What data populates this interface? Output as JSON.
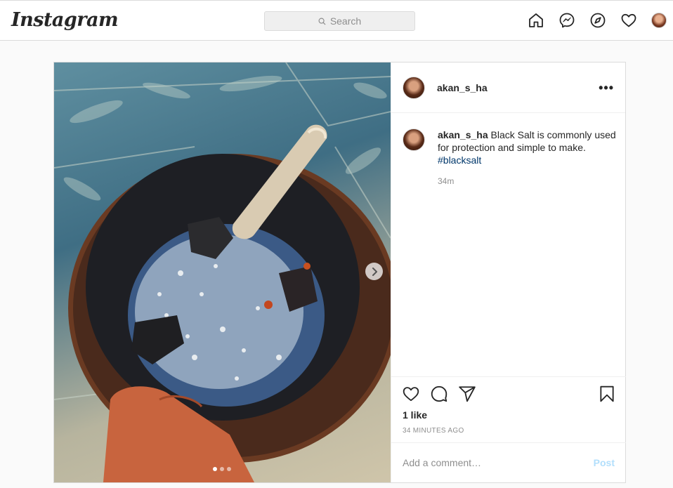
{
  "header": {
    "logo": "Instagram",
    "search_placeholder": "Search",
    "icons": [
      "home-icon",
      "messenger-icon",
      "explore-icon",
      "activity-heart-icon",
      "profile-avatar"
    ]
  },
  "post": {
    "username": "akan_s_ha",
    "caption": {
      "username": "akan_s_ha",
      "text": "Black Salt is commonly used for protection and simple to make.",
      "hashtag": "#blacksalt",
      "time": "34m"
    },
    "likes": "1 like",
    "time_ago": "34 MINUTES AGO",
    "comment_placeholder": "Add a comment…",
    "post_button": "Post",
    "carousel": {
      "count": 3,
      "active": 1
    }
  },
  "colors": {
    "link": "#00376b",
    "post_button_disabled": "#b2dffc",
    "border": "#dbdbdb",
    "background": "#fafafa"
  }
}
